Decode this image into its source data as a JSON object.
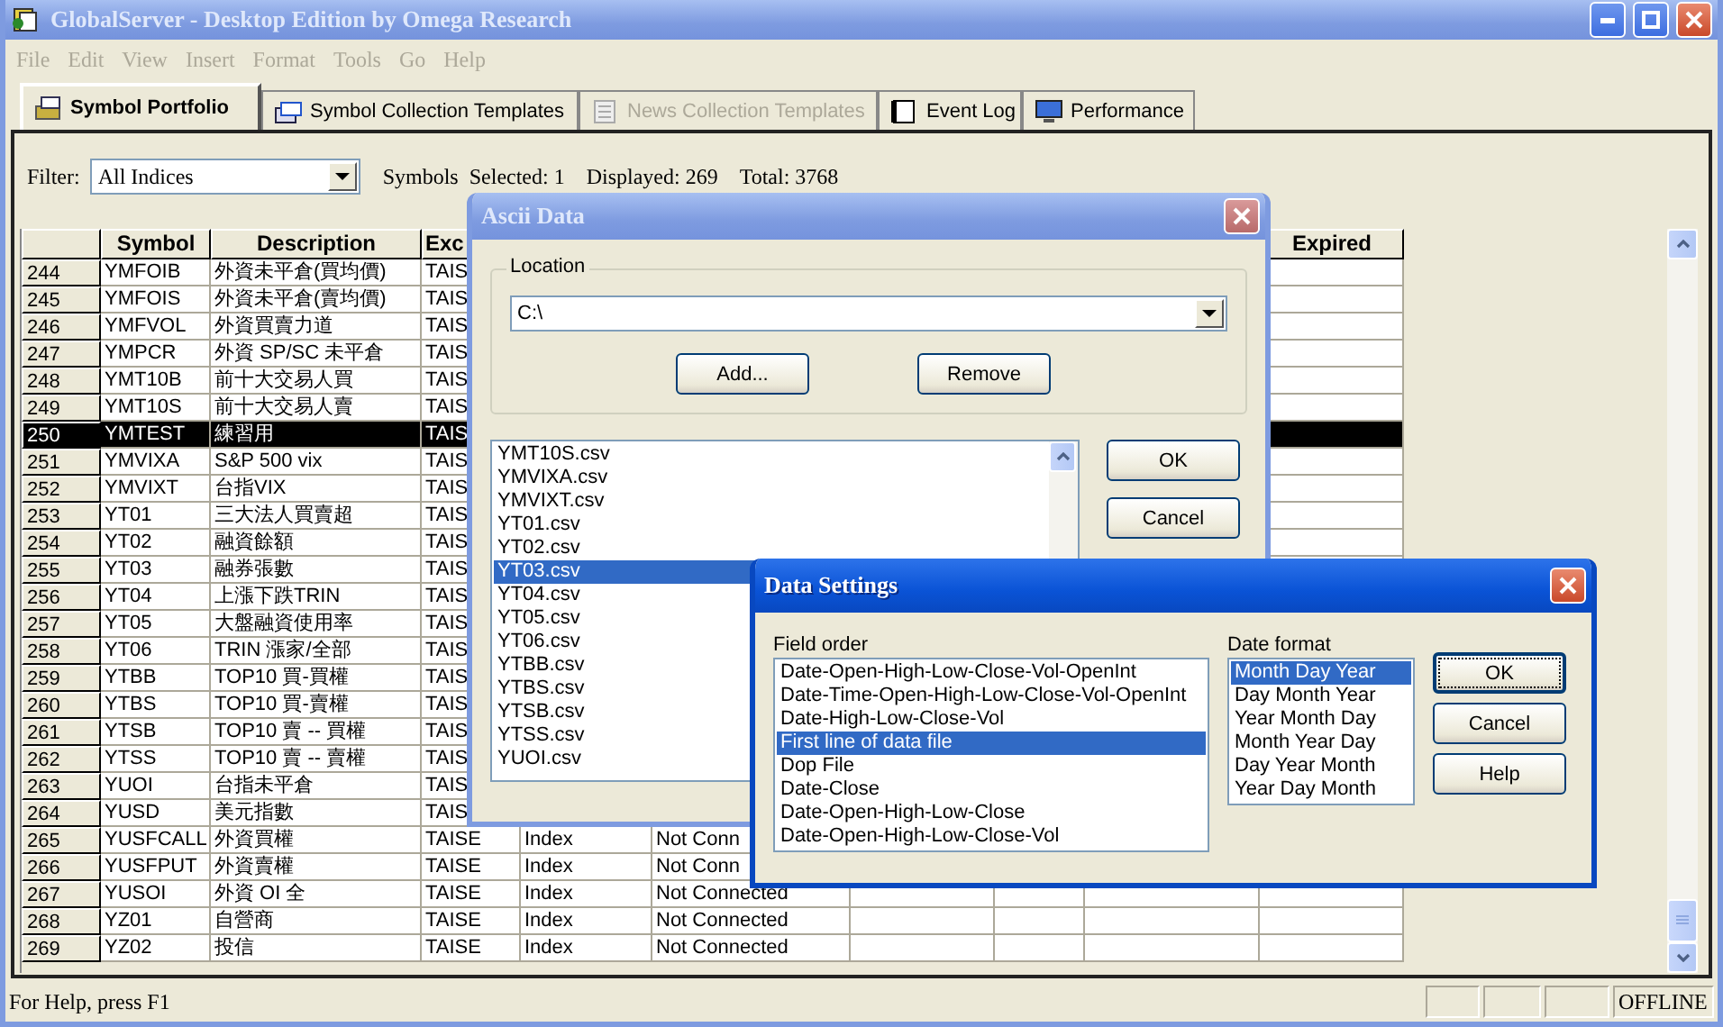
{
  "window": {
    "title": "GlobalServer - Desktop Edition by Omega Research"
  },
  "menu": [
    {
      "label": "File",
      "disabled": true
    },
    {
      "label": "Edit",
      "disabled": true
    },
    {
      "label": "View",
      "disabled": true
    },
    {
      "label": "Insert",
      "disabled": true
    },
    {
      "label": "Format",
      "disabled": true
    },
    {
      "label": "Tools",
      "disabled": true
    },
    {
      "label": "Go",
      "disabled": true
    },
    {
      "label": "Help",
      "disabled": true
    }
  ],
  "tabs": [
    {
      "label": "Symbol Portfolio",
      "selected": true,
      "disabled": false
    },
    {
      "label": "Symbol Collection Templates",
      "selected": false,
      "disabled": false
    },
    {
      "label": "News Collection Templates",
      "selected": false,
      "disabled": true
    },
    {
      "label": "Event Log",
      "selected": false,
      "disabled": false
    },
    {
      "label": "Performance",
      "selected": false,
      "disabled": false
    }
  ],
  "filter": {
    "label": "Filter:",
    "value": "All Indices"
  },
  "stats": [
    "Symbols  Selected: 1",
    "Displayed: 269",
    "Total: 3768"
  ],
  "table": {
    "headers": {
      "symbol": "Symbol",
      "description": "Description",
      "exchange": "Exc",
      "expired": "Expired"
    },
    "rows": [
      {
        "num": "244",
        "symbol": "YMFOIB",
        "description": "外資未平倉(買均價)",
        "exchange": "TAIS",
        "selected": false
      },
      {
        "num": "245",
        "symbol": "YMFOIS",
        "description": "外資未平倉(賣均價)",
        "exchange": "TAIS",
        "selected": false
      },
      {
        "num": "246",
        "symbol": "YMFVOL",
        "description": "外資買賣力道",
        "exchange": "TAIS",
        "selected": false
      },
      {
        "num": "247",
        "symbol": "YMPCR",
        "description": "外資 SP/SC 未平倉",
        "exchange": "TAIS",
        "selected": false
      },
      {
        "num": "248",
        "symbol": "YMT10B",
        "description": "前十大交易人買",
        "exchange": "TAIS",
        "selected": false
      },
      {
        "num": "249",
        "symbol": "YMT10S",
        "description": "前十大交易人賣",
        "exchange": "TAIS",
        "selected": false
      },
      {
        "num": "250",
        "symbol": "YMTEST",
        "description": "練習用",
        "exchange": "TAIS",
        "selected": true
      },
      {
        "num": "251",
        "symbol": "YMVIXA",
        "description": "S&P 500 vix",
        "exchange": "TAIS",
        "selected": false
      },
      {
        "num": "252",
        "symbol": "YMVIXT",
        "description": "台指VIX",
        "exchange": "TAIS",
        "selected": false
      },
      {
        "num": "253",
        "symbol": "YT01",
        "description": "三大法人買賣超",
        "exchange": "TAIS",
        "selected": false
      },
      {
        "num": "254",
        "symbol": "YT02",
        "description": "融資餘額",
        "exchange": "TAIS",
        "selected": false
      },
      {
        "num": "255",
        "symbol": "YT03",
        "description": "融券張數",
        "exchange": "TAIS",
        "selected": false
      },
      {
        "num": "256",
        "symbol": "YT04",
        "description": "上漲下跌TRIN",
        "exchange": "TAIS",
        "selected": false
      },
      {
        "num": "257",
        "symbol": "YT05",
        "description": "大盤融資使用率",
        "exchange": "TAIS",
        "selected": false
      },
      {
        "num": "258",
        "symbol": "YT06",
        "description": "TRIN 漲家/全部",
        "exchange": "TAIS",
        "selected": false
      },
      {
        "num": "259",
        "symbol": "YTBB",
        "description": "TOP10 買-買權",
        "exchange": "TAIS",
        "selected": false
      },
      {
        "num": "260",
        "symbol": "YTBS",
        "description": "TOP10 買-賣權",
        "exchange": "TAIS",
        "selected": false
      },
      {
        "num": "261",
        "symbol": "YTSB",
        "description": "TOP10 賣 -- 買權",
        "exchange": "TAIS",
        "selected": false
      },
      {
        "num": "262",
        "symbol": "YTSS",
        "description": "TOP10 賣 -- 賣權",
        "exchange": "TAIS",
        "selected": false
      },
      {
        "num": "263",
        "symbol": "YUOI",
        "description": "台指未平倉",
        "exchange": "TAIS",
        "selected": false
      },
      {
        "num": "264",
        "symbol": "YUSD",
        "description": "美元指數",
        "exchange": "TAIS",
        "selected": false
      },
      {
        "num": "265",
        "symbol": "YUSFCALL",
        "description": "外資買權",
        "exchange": "TAISE",
        "type": "Index",
        "status": "Not Conn",
        "selected": false
      },
      {
        "num": "266",
        "symbol": "YUSFPUT",
        "description": "外資賣權",
        "exchange": "TAISE",
        "type": "Index",
        "status": "Not Conn",
        "selected": false
      },
      {
        "num": "267",
        "symbol": "YUSOI",
        "description": "外資 OI 全",
        "exchange": "TAISE",
        "type": "Index",
        "status": "Not Connected",
        "selected": false
      },
      {
        "num": "268",
        "symbol": "YZ01",
        "description": "自營商",
        "exchange": "TAISE",
        "type": "Index",
        "status": "Not Connected",
        "selected": false
      },
      {
        "num": "269",
        "symbol": "YZ02",
        "description": "投信",
        "exchange": "TAISE",
        "type": "Index",
        "status": "Not Connected",
        "selected": false
      }
    ]
  },
  "ascii_dialog": {
    "title": "Ascii Data",
    "location_label": "Location",
    "location_value": "C:\\",
    "buttons": [
      "Add...",
      "Remove"
    ],
    "files": [
      {
        "name": "YMT10S.csv",
        "selected": false
      },
      {
        "name": "YMVIXA.csv",
        "selected": false
      },
      {
        "name": "YMVIXT.csv",
        "selected": false
      },
      {
        "name": "YT01.csv",
        "selected": false
      },
      {
        "name": "YT02.csv",
        "selected": false
      },
      {
        "name": "YT03.csv",
        "selected": true
      },
      {
        "name": "YT04.csv",
        "selected": false
      },
      {
        "name": "YT05.csv",
        "selected": false
      },
      {
        "name": "YT06.csv",
        "selected": false
      },
      {
        "name": "YTBB.csv",
        "selected": false
      },
      {
        "name": "YTBS.csv",
        "selected": false
      },
      {
        "name": "YTSB.csv",
        "selected": false
      },
      {
        "name": "YTSS.csv",
        "selected": false
      },
      {
        "name": "YUOI.csv",
        "selected": false
      }
    ],
    "side_buttons": [
      "OK",
      "Cancel"
    ]
  },
  "data_settings": {
    "title": "Data Settings",
    "field_order_label": "Field order",
    "field_orders": [
      {
        "label": "Date-Open-High-Low-Close-Vol-OpenInt",
        "selected": false
      },
      {
        "label": "Date-Time-Open-High-Low-Close-Vol-OpenInt",
        "selected": false
      },
      {
        "label": "Date-High-Low-Close-Vol",
        "selected": false
      },
      {
        "label": "First line of data file",
        "selected": true
      },
      {
        "label": "Dop File",
        "selected": false
      },
      {
        "label": "Date-Close",
        "selected": false
      },
      {
        "label": "Date-Open-High-Low-Close",
        "selected": false
      },
      {
        "label": "Date-Open-High-Low-Close-Vol",
        "selected": false
      }
    ],
    "date_format_label": "Date format",
    "date_formats": [
      {
        "label": "Month Day Year",
        "selected": true
      },
      {
        "label": "Day Month Year",
        "selected": false
      },
      {
        "label": "Year Month Day",
        "selected": false
      },
      {
        "label": "Month Year Day",
        "selected": false
      },
      {
        "label": "Day Year Month",
        "selected": false
      },
      {
        "label": "Year Day Month",
        "selected": false
      }
    ],
    "buttons": [
      {
        "label": "OK",
        "default": true
      },
      {
        "label": "Cancel",
        "default": false
      },
      {
        "label": "Help",
        "default": false
      }
    ]
  },
  "status_bar": {
    "help": "For Help, press F1",
    "mode": "OFFLINE"
  }
}
